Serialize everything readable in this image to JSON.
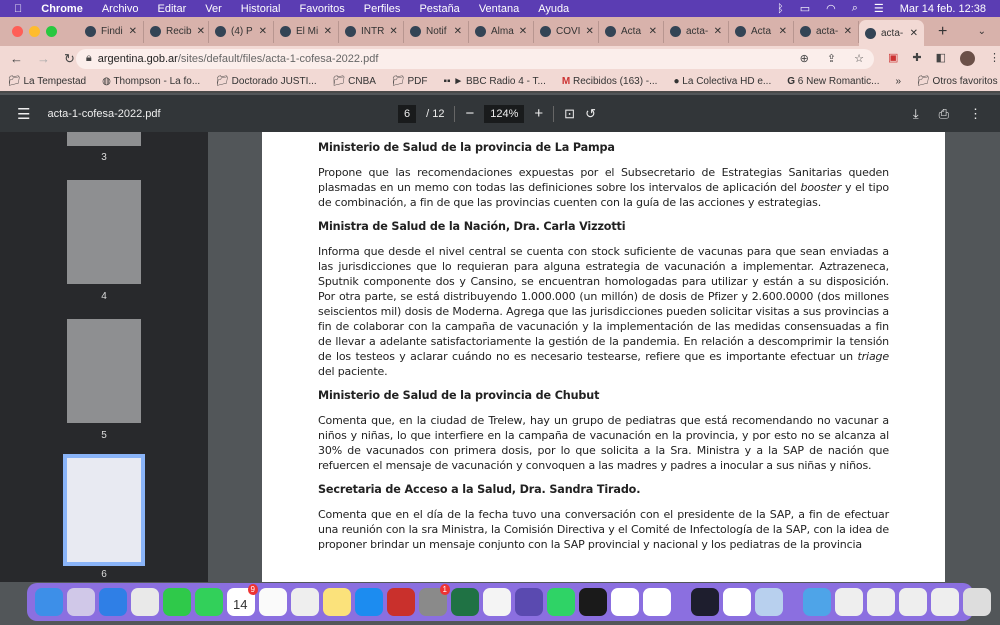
{
  "menubar": {
    "app": "Chrome",
    "items": [
      "Archivo",
      "Editar",
      "Ver",
      "Historial",
      "Favoritos",
      "Perfiles",
      "Pestaña",
      "Ventana",
      "Ayuda"
    ],
    "clock": "Mar 14 feb.  12:38"
  },
  "tabs": [
    {
      "label": "Findi"
    },
    {
      "label": "Recib"
    },
    {
      "label": "(4) P"
    },
    {
      "label": "El Mi"
    },
    {
      "label": "INTR"
    },
    {
      "label": "Notif"
    },
    {
      "label": "Alma"
    },
    {
      "label": "COVI"
    },
    {
      "label": "Acta"
    },
    {
      "label": "acta-"
    },
    {
      "label": "Acta"
    },
    {
      "label": "acta-"
    },
    {
      "label": "acta-",
      "active": true
    }
  ],
  "address": {
    "host": "argentina.gob.ar",
    "path": "/sites/default/files/acta-1-cofesa-2022.pdf"
  },
  "bookmarks": [
    "La Tempestad",
    "Thompson - La fo...",
    "Doctorado JUSTI...",
    "CNBA",
    "PDF",
    "► BBC Radio 4 - T...",
    "Recibidos (163) -...",
    "La Colectiva HD e...",
    "6 New Romantic..."
  ],
  "bookmarks_other": "Otros favoritos",
  "pdf": {
    "filename": "acta-1-cofesa-2022.pdf",
    "page": "6",
    "total": "/ 12",
    "zoom": "124%"
  },
  "thumbnails": [
    {
      "num": "3"
    },
    {
      "num": "4"
    },
    {
      "num": "5"
    },
    {
      "num": "6",
      "selected": true
    }
  ],
  "document": {
    "h1": "Ministerio de Salud de la provincia de La Pampa",
    "p1a": "Propone que las recomendaciones expuestas por el Subsecretario de Estrategias Sanitarias queden plasmadas en un memo con todas las definiciones sobre los intervalos de aplicación del ",
    "p1i": "booster",
    "p1b": " y el tipo de combinación, a fin de que las provincias cuenten con la guía de las acciones y estrategias.",
    "h2": "Ministra de Salud de la Nación, Dra. Carla Vizzotti",
    "p2a": "Informa que desde el nivel central se cuenta con stock suficiente de vacunas para que sean enviadas a las jurisdicciones que lo requieran para alguna estrategia de vacunación a implementar. Aztrazeneca, Sputnik componente dos y Cansino, se encuentran homologadas para utilizar y están a su disposición. Por otra parte, se está distribuyendo 1.000.000 (un millón) de dosis de Pfizer y 2.600.0000 (dos millones seiscientos mil) dosis de Moderna. Agrega que las jurisdicciones pueden solicitar visitas a sus provincias a fin de colaborar con la campaña de vacunación y la implementación de las medidas consensuadas a fin de llevar a adelante satisfactoriamente la gestión de la pandemia. En relación a descomprimir la tensión de los testeos y aclarar cuándo no es necesario testearse, refiere que es importante efectuar un ",
    "p2i": "triage",
    "p2b": " del paciente.",
    "h3": "Ministerio de Salud de la provincia de Chubut",
    "p3": "Comenta que, en la ciudad de Trelew, hay un grupo de pediatras que está recomendando no vacunar a niños y niñas, lo que interfiere en la campaña de vacunación en la provincia, y por esto no se alcanza al 30% de vacunados con primera dosis, por lo que solicita a la Sra. Ministra y a la SAP de nación que refuercen el mensaje de vacunación y convoquen a las madres y padres a inocular a sus niñas y niños.",
    "h4": "Secretaria de Acceso a la Salud, Dra. Sandra Tirado.",
    "p4": "Comenta que en el día de la fecha tuvo una conversación con el presidente de la SAP, a fin de efectuar una reunión con la sra Ministra, la Comisión Directiva y el Comité de Infectología de la SAP, con la idea de proponer brindar un mensaje conjunto con la SAP provincial y nacional y los pediatras de la provincia"
  },
  "dock": {
    "calendar_date": "14",
    "calendar_badge": "9",
    "settings_badge": "1",
    "apps": [
      {
        "name": "finder",
        "color": "#3d8fe8"
      },
      {
        "name": "launchpad",
        "color": "#d0c8e8"
      },
      {
        "name": "mail",
        "color": "#2f7fe6"
      },
      {
        "name": "chrome",
        "color": "#e9e9e9"
      },
      {
        "name": "facetime",
        "color": "#2fc94a"
      },
      {
        "name": "messages",
        "color": "#32d05a"
      },
      {
        "name": "calendar",
        "color": "#ffffff"
      },
      {
        "name": "reminders",
        "color": "#fafafa"
      },
      {
        "name": "textedit",
        "color": "#eeeeee"
      },
      {
        "name": "notes",
        "color": "#fbe27b"
      },
      {
        "name": "app-store",
        "color": "#1c8cf0"
      },
      {
        "name": "zotero",
        "color": "#c9302c"
      },
      {
        "name": "system-preferences",
        "color": "#8a8a8a"
      },
      {
        "name": "excel",
        "color": "#1f7244"
      },
      {
        "name": "photos",
        "color": "#f4f4f4"
      },
      {
        "name": "prime-video",
        "color": "#5a4ab0"
      },
      {
        "name": "whatsapp",
        "color": "#2fd366"
      },
      {
        "name": "spotify",
        "color": "#1a1a1a"
      },
      {
        "name": "messenger",
        "color": "#ffffff"
      },
      {
        "name": "slack",
        "color": "#ffffff"
      },
      {
        "name": "powershell",
        "color": "#1e1e2e"
      },
      {
        "name": "powerpoint",
        "color": "#ffffff"
      },
      {
        "name": "preview",
        "color": "#b8d0ee"
      },
      {
        "name": "downloads",
        "color": "#4ea4e8"
      },
      {
        "name": "doc-1",
        "color": "#eeeeee"
      },
      {
        "name": "doc-2",
        "color": "#eeeeee"
      },
      {
        "name": "doc-3",
        "color": "#eeeeee"
      },
      {
        "name": "doc-4",
        "color": "#eeeeee"
      },
      {
        "name": "trash",
        "color": "#dddddd"
      }
    ]
  }
}
